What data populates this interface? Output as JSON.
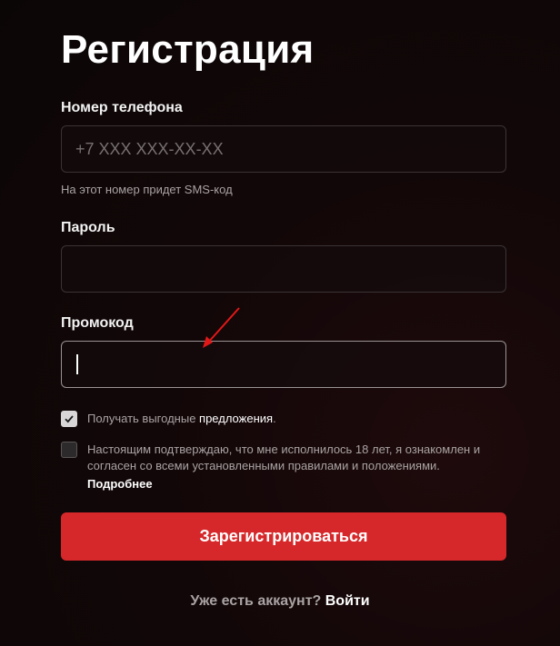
{
  "page_title": "Регистрация",
  "phone": {
    "label": "Номер телефона",
    "placeholder": "+7 XXX XXX-XX-XX",
    "value": "",
    "hint": "На этот номер придет SMS-код"
  },
  "password": {
    "label": "Пароль",
    "value": ""
  },
  "promo": {
    "label": "Промокод",
    "value": ""
  },
  "offers_checkbox": {
    "checked": true,
    "text_prefix": "Получать выгодные ",
    "text_link": "предложения",
    "text_suffix": "."
  },
  "age_checkbox": {
    "checked": false,
    "text": "Настоящим подтверждаю, что мне исполнилось 18 лет, я ознакомлен и согласен со всеми установленными правилами и положениями.",
    "more_label": "Подробнее"
  },
  "submit_label": "Зарегистрироваться",
  "login_prompt": {
    "question": "Уже есть аккаунт?",
    "link_label": "Войти"
  },
  "colors": {
    "accent": "#d6282a",
    "annotation_arrow": "#e01818"
  },
  "icons": {
    "checkmark": "check-icon",
    "annotation": "arrow-icon"
  }
}
